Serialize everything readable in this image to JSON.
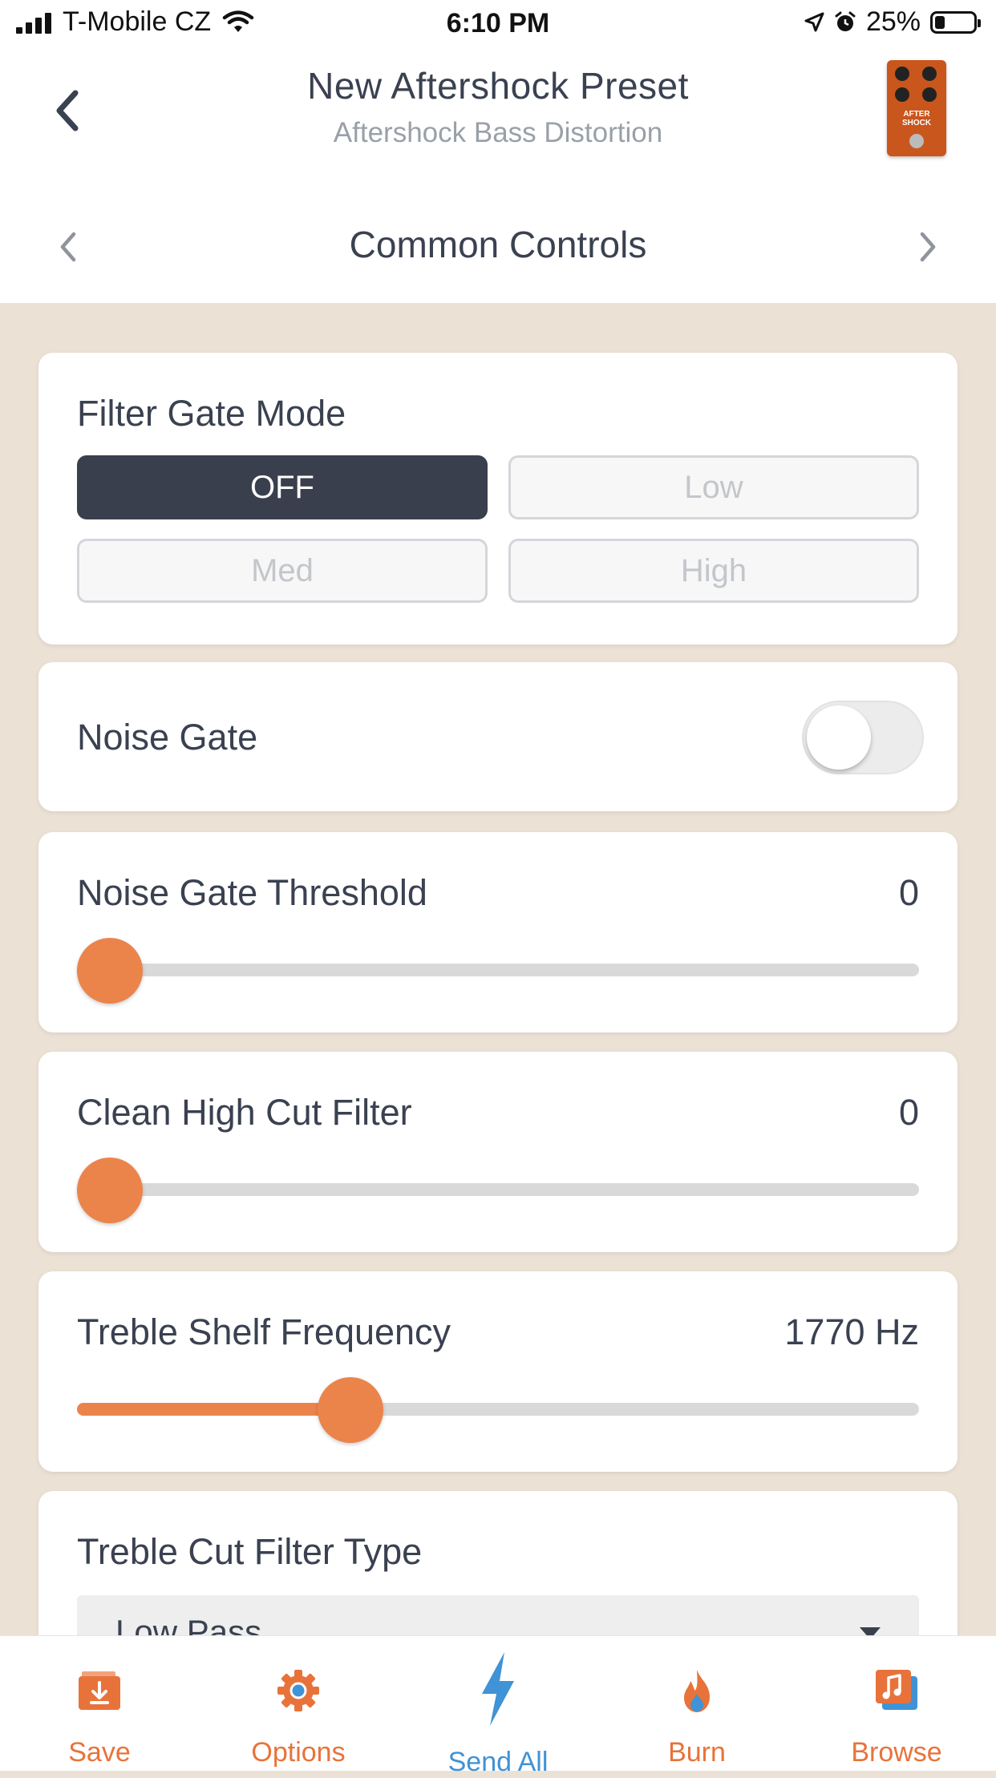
{
  "status_bar": {
    "carrier": "T-Mobile CZ",
    "time": "6:10 PM",
    "battery": "25%",
    "battery_level": 0.25
  },
  "header": {
    "title": "New Aftershock Preset",
    "subtitle": "Aftershock Bass Distortion",
    "pedal_image_text": "AFTER SHOCK"
  },
  "section": {
    "title": "Common Controls"
  },
  "filter_gate_mode": {
    "label": "Filter Gate Mode",
    "options": [
      "OFF",
      "Low",
      "Med",
      "High"
    ],
    "selected": "OFF"
  },
  "noise_gate": {
    "label": "Noise Gate",
    "enabled": false
  },
  "noise_gate_threshold": {
    "label": "Noise Gate Threshold",
    "value": "0",
    "position": 0
  },
  "clean_high_cut": {
    "label": "Clean High Cut Filter",
    "value": "0",
    "position": 0
  },
  "treble_shelf_frequency": {
    "label": "Treble Shelf Frequency",
    "value": "1770 Hz",
    "position": 0.325
  },
  "treble_cut_filter_type": {
    "label": "Treble Cut Filter Type",
    "value": "Low Pass"
  },
  "tabs": {
    "save": "Save",
    "options": "Options",
    "send_all": "Send All",
    "burn": "Burn",
    "browse": "Browse"
  },
  "colors": {
    "accent": "#eb844b",
    "dark": "#3a3f4d",
    "send_blue": "#3f93d6",
    "background": "#ece1d5"
  }
}
